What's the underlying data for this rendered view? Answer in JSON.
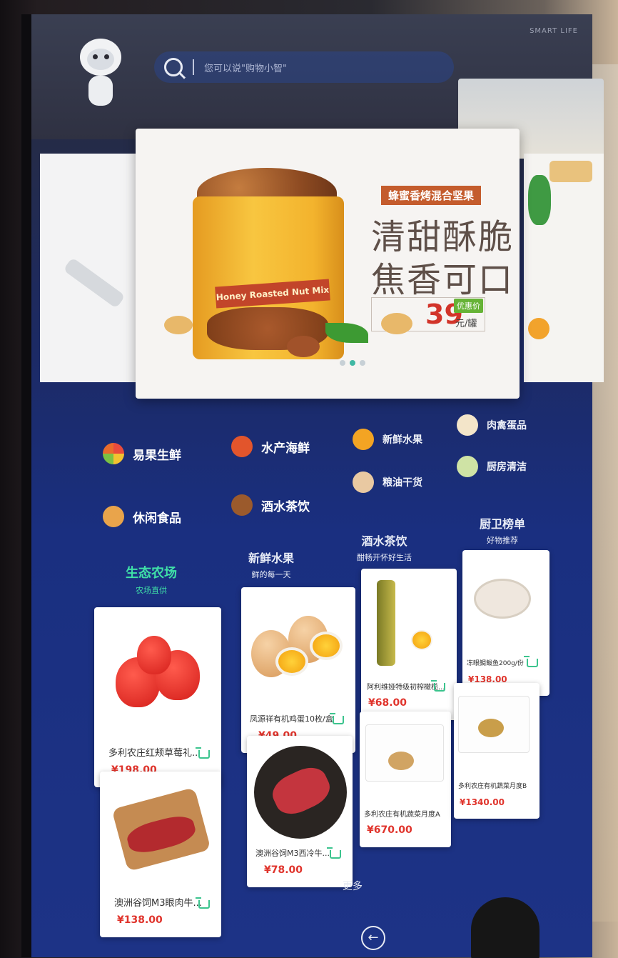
{
  "top_bar": {
    "brand": "SMART LIFE",
    "search_placeholder": "您可以说\"购物小智\""
  },
  "banner": {
    "subtitle": "蜂蜜香烤混合坚果",
    "headline_line1": "清甜酥脆",
    "headline_line2": "焦香可口",
    "price": "39",
    "promo": "优惠价",
    "unit": "元/罐",
    "can_label": "Honey Roasted Nut Mix",
    "slides": 3,
    "active_slide": 2
  },
  "categories": [
    {
      "label": "易果生鲜",
      "icon": "fruit-cluster-icon"
    },
    {
      "label": "水产海鲜",
      "icon": "crab-icon"
    },
    {
      "label": "新鲜水果",
      "icon": "orange-icon"
    },
    {
      "label": "肉禽蛋品",
      "icon": "chicken-leg-icon"
    },
    {
      "label": "休闲食品",
      "icon": "snack-icon"
    },
    {
      "label": "酒水茶饮",
      "icon": "teapot-icon"
    },
    {
      "label": "粮油干货",
      "icon": "rice-bag-icon"
    },
    {
      "label": "厨房清洁",
      "icon": "brush-icon"
    }
  ],
  "tabs": [
    {
      "title": "生态农场",
      "sub": "农场直供"
    },
    {
      "title": "新鲜水果",
      "sub": "鲜的每一天"
    },
    {
      "title": "酒水茶饮",
      "sub": "酣畅开怀好生活"
    },
    {
      "title": "厨卫榜单",
      "sub": "好物推荐"
    }
  ],
  "products": [
    {
      "name": "多利农庄红颊草莓礼...",
      "price": "¥198.00"
    },
    {
      "name": "凤源祥有机鸡蛋10枚/盒",
      "price": "¥49.00"
    },
    {
      "name": "阿利维娅特级初榨橄榄...",
      "price": "¥68.00"
    },
    {
      "name": "冻眼鲷鲅鱼200g/份",
      "price": "¥138.00"
    },
    {
      "name": "澳洲谷饲M3眼肉牛...",
      "price": "¥138.00"
    },
    {
      "name": "澳洲谷饲M3西冷牛...",
      "price": "¥78.00"
    },
    {
      "name": "多利农庄有机蔬菜月度A",
      "price": "¥670.00"
    },
    {
      "name": "多利农庄有机蔬菜月度B",
      "price": "¥1340.00"
    }
  ],
  "more_label": "更多",
  "back_label": "←",
  "colors": {
    "accent": "#3fe0a7",
    "price": "#e0342c",
    "screen_blue": "#1d3386"
  }
}
